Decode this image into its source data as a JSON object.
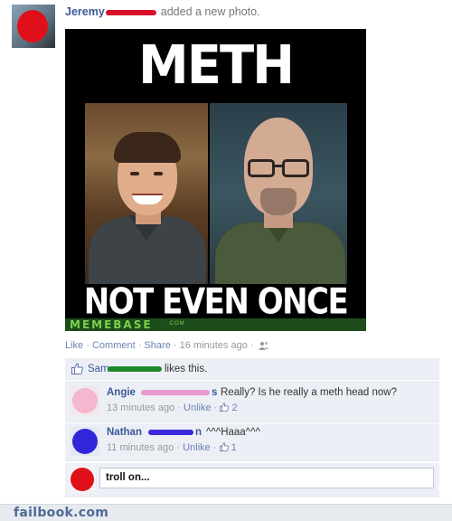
{
  "post": {
    "author": "Jeremy",
    "action": "added a new photo."
  },
  "meme": {
    "top_text": "METH",
    "bottom_text": "NOT EVEN ONCE",
    "brand": "MEMEBASE",
    "brand_suffix": ".COM"
  },
  "actions": {
    "like": "Like",
    "comment": "Comment",
    "share": "Share",
    "timestamp": "16 minutes ago",
    "sep": "·"
  },
  "likes": {
    "name": "Sam",
    "text": "likes this."
  },
  "comments": [
    {
      "name": "Angie",
      "text": "Really? Is he really a meth head now?",
      "name_tail": "s",
      "time": "13 minutes ago",
      "unlike": "Unlike",
      "like_count": "2"
    },
    {
      "name": "Nathan",
      "name_tail": "n",
      "text": "^^^Haaa^^^",
      "time": "11 minutes ago",
      "unlike": "Unlike",
      "like_count": "1"
    }
  ],
  "reply": {
    "value": "troll on..."
  },
  "footer": {
    "site": "failbook.com"
  }
}
